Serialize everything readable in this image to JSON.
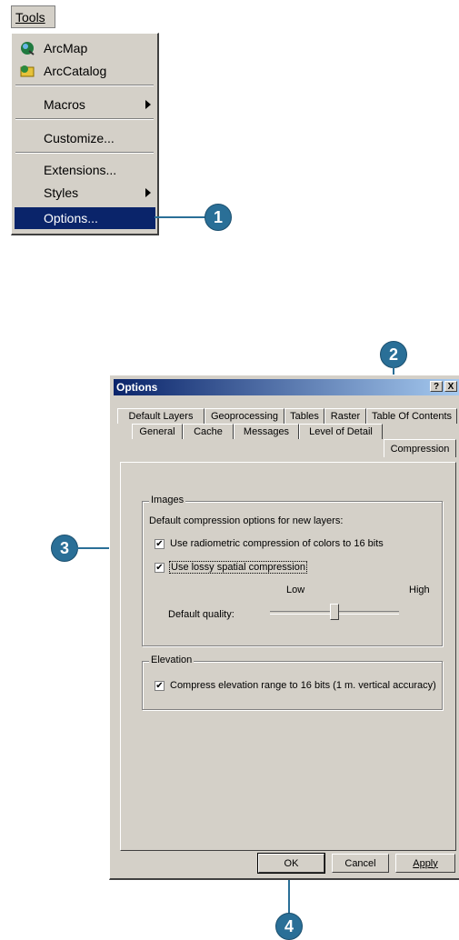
{
  "menu": {
    "title": "Tools",
    "items": [
      {
        "label": "ArcMap",
        "icon": "arcmap-icon"
      },
      {
        "label": "ArcCatalog",
        "icon": "arccatalog-icon"
      },
      {
        "label": "Macros",
        "submenu": true
      },
      {
        "label": "Customize..."
      },
      {
        "label": "Extensions..."
      },
      {
        "label": "Styles",
        "submenu": true
      },
      {
        "label": "Options...",
        "selected": true
      }
    ]
  },
  "callouts": [
    "1",
    "2",
    "3",
    "4"
  ],
  "dialog": {
    "title": "Options",
    "title_buttons": [
      "?",
      "X"
    ],
    "tabs_back": [
      "Default Layers",
      "Geoprocessing",
      "Tables",
      "Raster",
      "Table Of Contents"
    ],
    "tabs_front": [
      "General",
      "Cache",
      "Messages",
      "Level of Detail",
      "Compression"
    ],
    "active_tab": "Compression",
    "images_group": {
      "title": "Images",
      "description": "Default compression options for new layers:",
      "radiometric_label": "Use radiometric compression of colors to 16 bits",
      "radiometric_checked": true,
      "lossy_label": "Use lossy spatial compression",
      "lossy_checked": true,
      "quality_label": "Default quality:",
      "low_label": "Low",
      "high_label": "High",
      "quality_value": 0.5
    },
    "elevation_group": {
      "title": "Elevation",
      "compress_label": "Compress elevation range to 16 bits (1 m. vertical accuracy)",
      "compress_checked": true
    },
    "buttons": {
      "ok": "OK",
      "cancel": "Cancel",
      "apply": "Apply"
    }
  },
  "colors": {
    "callout": "#2a6f97",
    "selection": "#0a246a",
    "face": "#d4d0c8"
  }
}
